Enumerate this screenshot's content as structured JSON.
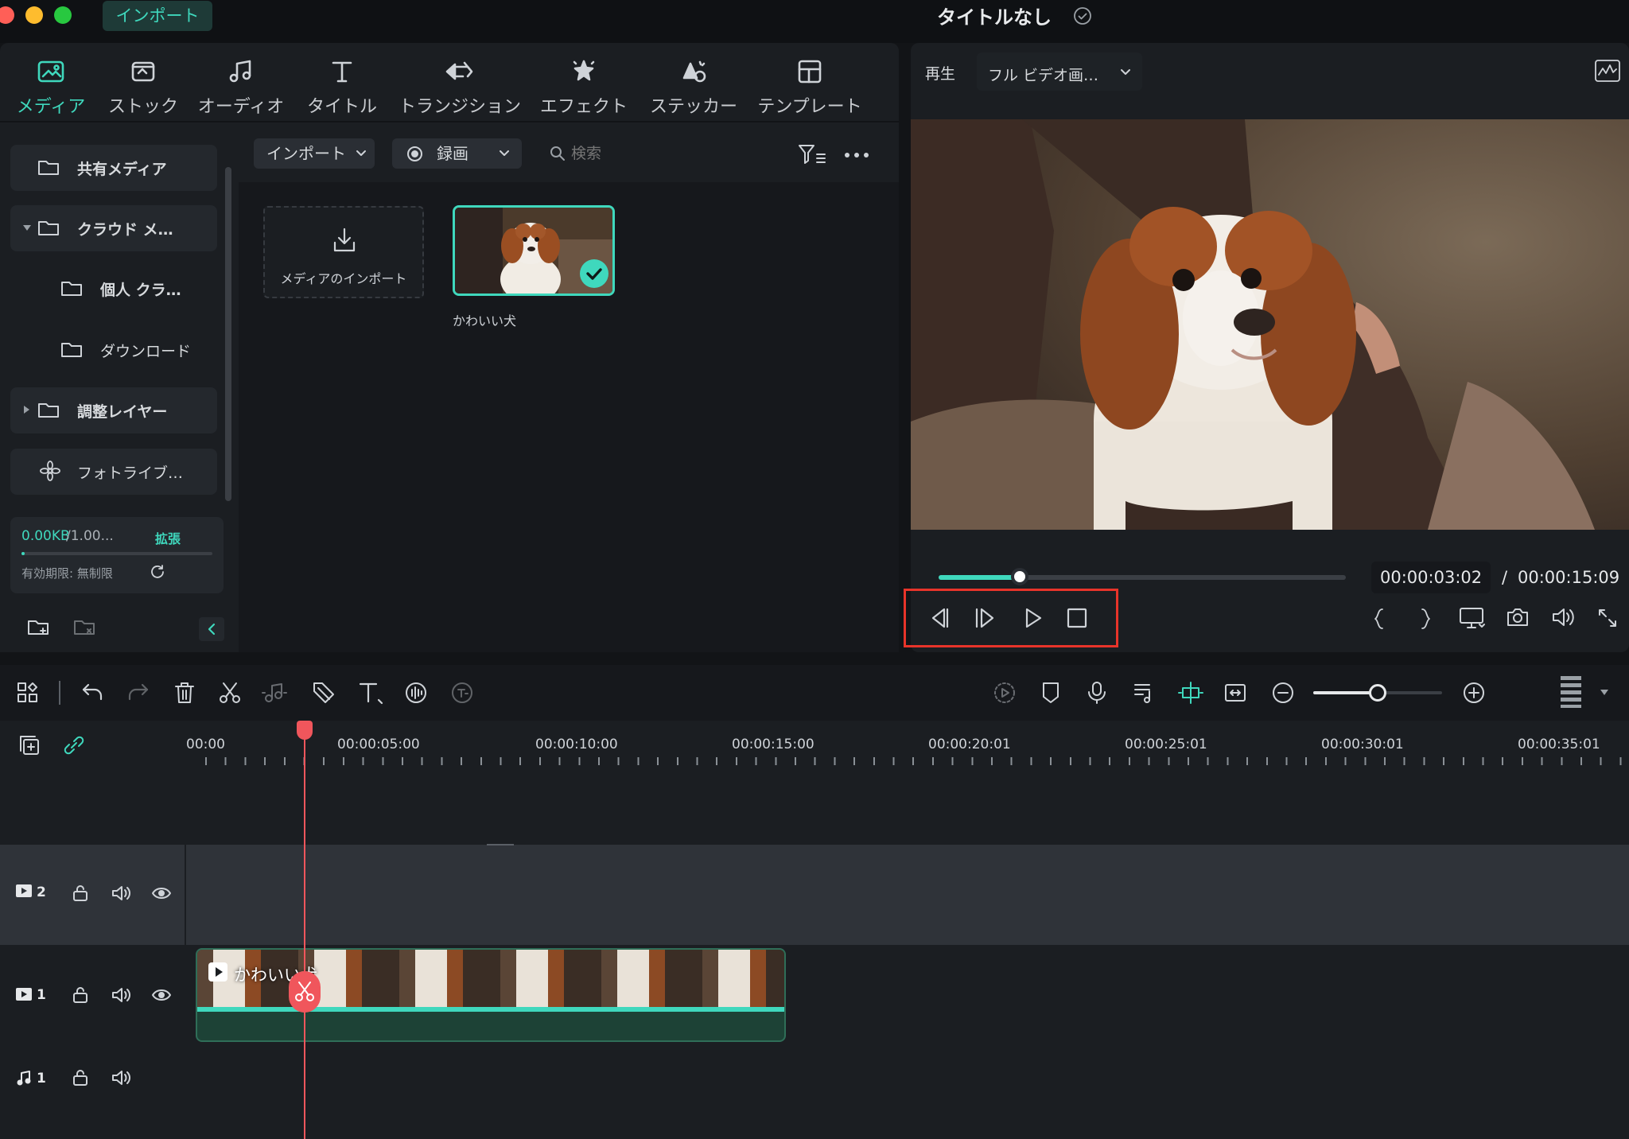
{
  "window": {
    "title": "タイトルなし",
    "import_chip": "インポート",
    "traffic_colors": [
      "#ff5f57",
      "#febc2e",
      "#28c840"
    ]
  },
  "tabs": [
    {
      "label": "メディア",
      "icon": "media-icon",
      "active": true
    },
    {
      "label": "ストック",
      "icon": "stock-icon",
      "active": false
    },
    {
      "label": "オーディオ",
      "icon": "music-note-icon",
      "active": false
    },
    {
      "label": "タイトル",
      "icon": "title-t-icon",
      "active": false
    },
    {
      "label": "トランジション",
      "icon": "transition-icon",
      "active": false
    },
    {
      "label": "エフェクト",
      "icon": "effect-icon",
      "active": false
    },
    {
      "label": "ステッカー",
      "icon": "sticker-icon",
      "active": false
    },
    {
      "label": "テンプレート",
      "icon": "template-icon",
      "active": false
    }
  ],
  "sidebar": {
    "items": [
      {
        "label": "共有メディア",
        "icon": "folder-icon"
      },
      {
        "label": "クラウド メ…",
        "icon": "folder-icon",
        "expanded": true
      },
      {
        "label": "個人 クラ…",
        "icon": "folder-icon"
      },
      {
        "label": "ダウンロード",
        "icon": "folder-icon"
      },
      {
        "label": "調整レイヤー",
        "icon": "folder-icon",
        "collapsed": true
      },
      {
        "label": "フォトライブ…",
        "icon": "flower-icon"
      }
    ],
    "storage": {
      "used": "0.00KB",
      "total": "/1.00...",
      "expand": "拡張",
      "expiry": "有効期限: 無制限"
    }
  },
  "media_toolbar": {
    "import_dropdown": "インポート",
    "record_dropdown": "録画",
    "search_placeholder": "検索"
  },
  "media": {
    "import_tile_label": "メディアのインポート",
    "clips": [
      {
        "name": "かわいい犬",
        "selected": true
      }
    ]
  },
  "preview": {
    "play_label": "再生",
    "quality": "フル ビデオ画…",
    "current_time": "00:00:03:02",
    "separator": "/",
    "total_time": "00:00:15:09",
    "progress": 0.2
  },
  "timeline": {
    "ruler": [
      "00:00",
      "00:00:05:00",
      "00:00:10:00",
      "00:00:15:00",
      "00:00:20:01",
      "00:00:25:01",
      "00:00:30:01",
      "00:00:35:01"
    ],
    "tracks": [
      {
        "type": "video",
        "number": "2"
      },
      {
        "type": "video",
        "number": "1"
      },
      {
        "type": "audio",
        "number": "1"
      }
    ],
    "clip_name": "かわいい犬",
    "zoom_level": 0.5,
    "accent": "#3fd8bd",
    "playhead_color": "#f0565c"
  }
}
